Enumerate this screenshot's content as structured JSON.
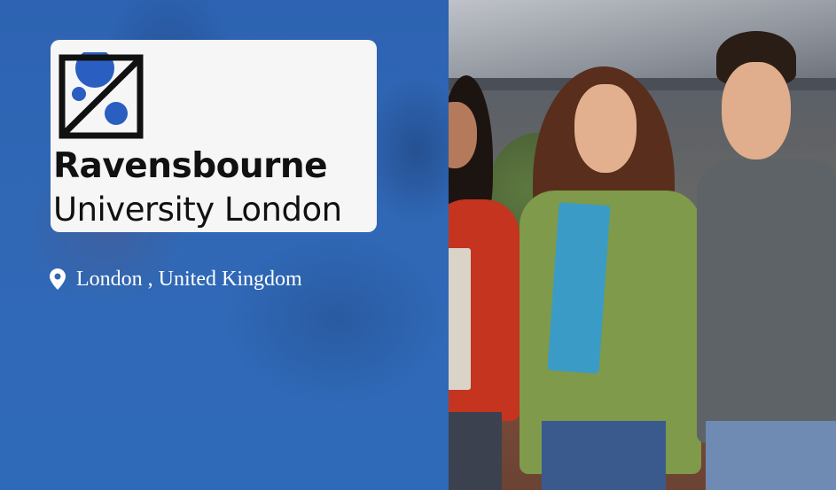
{
  "logo": {
    "line1": "Ravensbourne",
    "line2": "University London",
    "icon": "ravensbourne-logo-mark"
  },
  "location": {
    "icon": "map-pin-icon",
    "text": "London , United Kingdom"
  },
  "colors": {
    "panel_blue": "#2f66b4",
    "logo_blue": "#2a5ec1",
    "card_bg": "#f6f6f7",
    "text_white": "#ffffff"
  },
  "photo": {
    "subject": "students-photo"
  }
}
